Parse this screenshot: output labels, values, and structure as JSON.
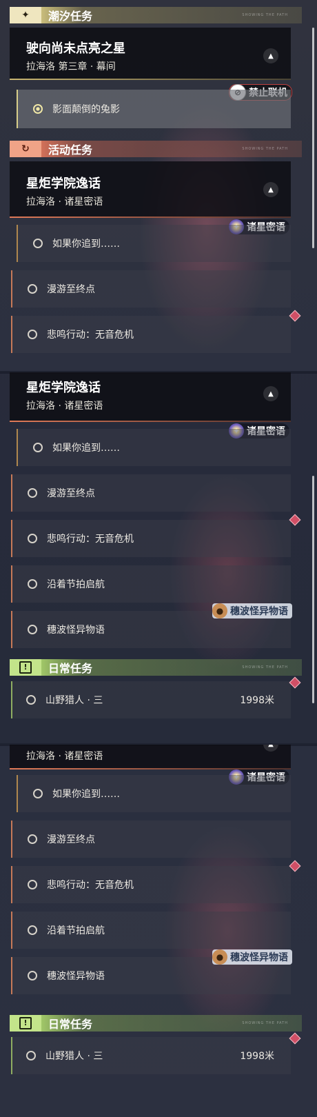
{
  "sections": {
    "tide": "潮汐任务",
    "activity": "活动任务",
    "daily": "日常任务",
    "tail": "SHOWING THE PATH"
  },
  "tide_quest": {
    "title": "驶向尚未点亮之星",
    "subtitle": "拉海洛 第三章 · 幕间",
    "step": "影面颠倒的兔影",
    "badge": "禁止联机"
  },
  "activity_quest": {
    "title": "星炬学院逸话",
    "subtitle": "拉海洛 · 诸星密语",
    "badge": "诸星密语",
    "steps": [
      "如果你追到……",
      "漫游至终点",
      "悲鸣行动：无音危机",
      "沿着节拍启航",
      "穗波怪异物语"
    ],
    "wave_badge": "穗波怪异物语"
  },
  "daily_quest": {
    "name": "山野猎人 · 三",
    "distance": "1998米"
  },
  "icons": {
    "tide": "sparkle-icon",
    "activity": "refresh-icon",
    "daily": "alert-box-icon",
    "collapse": "chevron-up-icon"
  },
  "colors": {
    "tide": "#e7dfb4",
    "activity": "#e8896a",
    "daily": "#b9dc7f",
    "marker": "#d14f66"
  }
}
